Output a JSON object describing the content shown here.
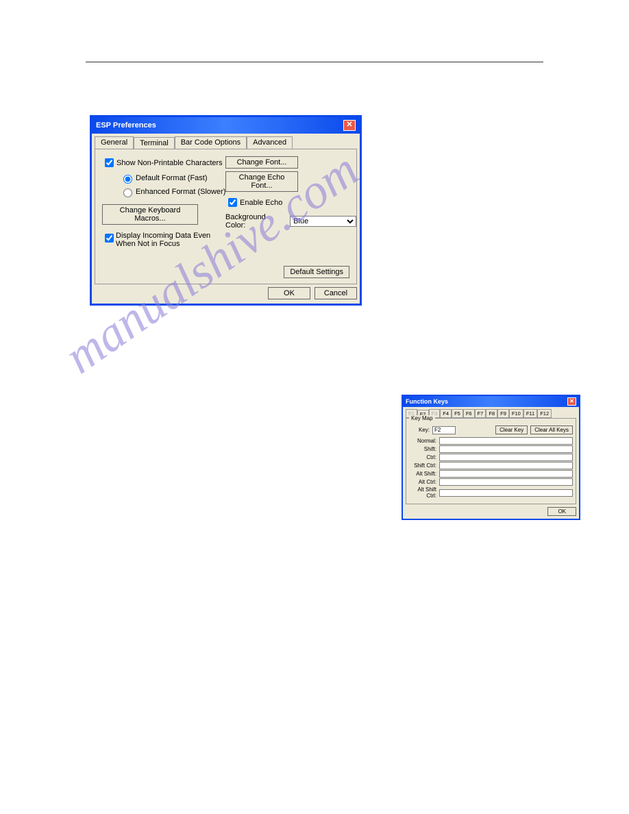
{
  "watermark": "manualshive.com",
  "dialog1": {
    "title": "ESP Preferences",
    "tabs": [
      "General",
      "Terminal",
      "Bar Code Options",
      "Advanced"
    ],
    "active_tab_index": 1,
    "left": {
      "show_np": "Show Non-Printable Characters",
      "show_np_checked": true,
      "default_format": "Default Format (Fast)",
      "default_format_checked": true,
      "enhanced_format": "Enhanced Format (Slower)",
      "enhanced_format_checked": false,
      "keyboard_macros": "Change Keyboard Macros...",
      "incoming": "Display Incoming Data Even\nWhen Not in Focus",
      "incoming_checked": true
    },
    "right": {
      "change_font": "Change Font...",
      "change_echo": "Change Echo Font...",
      "enable_echo": "Enable Echo",
      "enable_echo_checked": true,
      "bg_label": "Background Color:",
      "bg_value": "Blue"
    },
    "default_settings": "Default Settings",
    "ok": "OK",
    "cancel": "Cancel"
  },
  "dialog2": {
    "title": "Function Keys",
    "fkeys": [
      "F1",
      "F2",
      "F3",
      "F4",
      "F5",
      "F6",
      "F7",
      "F8",
      "F9",
      "F10",
      "F11",
      "F12"
    ],
    "active_index": 1,
    "dim_indices": [
      0,
      2
    ],
    "keymap_legend": "Key Map",
    "key_label": "Key:",
    "key_value": "F2",
    "clear_key": "Clear Key",
    "clear_all": "Clear All Keys",
    "rows": [
      "Normal:",
      "Shift:",
      "Ctrl:",
      "Shift Ctrl:",
      "Alt Shift:",
      "Alt Ctrl:",
      "Alt Shift Ctrl:"
    ],
    "ok": "OK"
  }
}
